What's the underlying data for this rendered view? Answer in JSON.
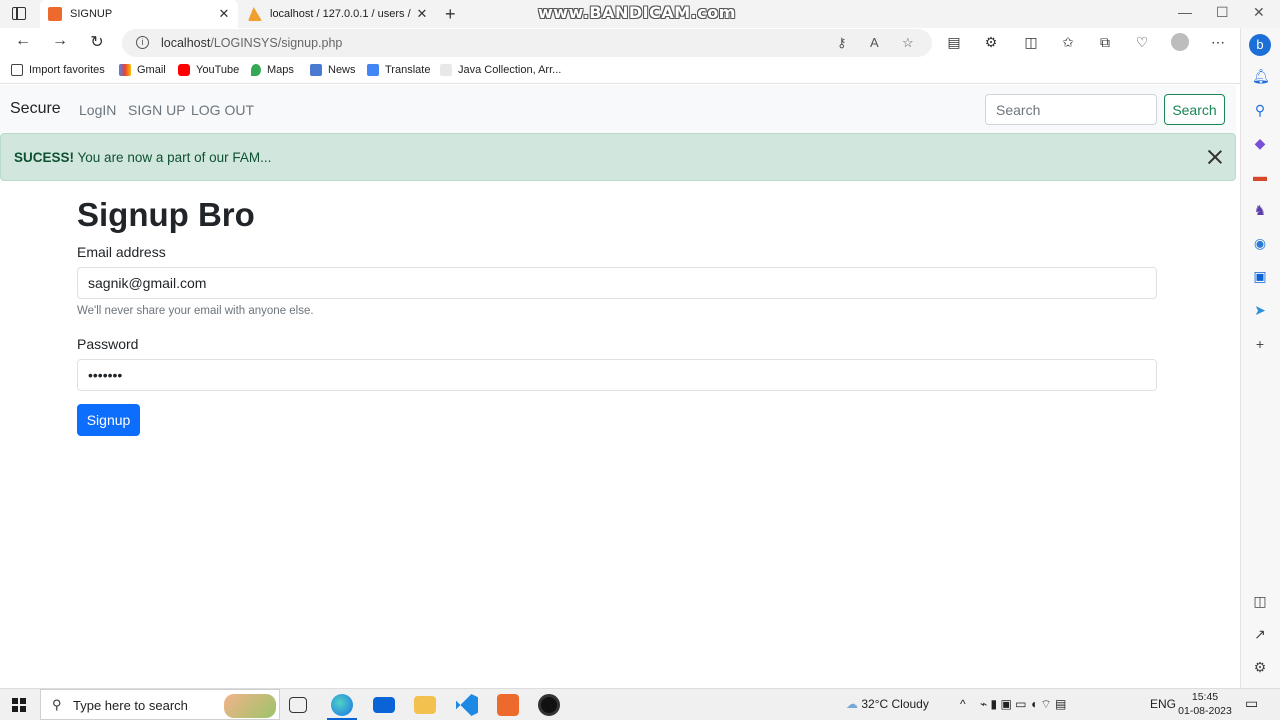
{
  "browser": {
    "tabs": [
      {
        "title": "SIGNUP",
        "active": true
      },
      {
        "title": "localhost / 127.0.0.1 / users / use",
        "active": false
      }
    ],
    "recorder_watermark": "www.BANDICAM.com",
    "url_host": "localhost",
    "url_path": "/LOGINSYS/signup.php",
    "favorites": [
      {
        "label": "Import favorites",
        "icon": "import-icon"
      },
      {
        "label": "Gmail",
        "icon": "gmail-icon"
      },
      {
        "label": "YouTube",
        "icon": "youtube-icon"
      },
      {
        "label": "Maps",
        "icon": "maps-icon"
      },
      {
        "label": "News",
        "icon": "news-icon"
      },
      {
        "label": "Translate",
        "icon": "translate-icon"
      },
      {
        "label": "Java Collection, Arr...",
        "icon": "w3-icon"
      }
    ]
  },
  "navbar": {
    "brand": "Secure",
    "links": [
      "LogIN",
      "SIGN UP",
      "LOG OUT"
    ],
    "search_placeholder": "Search",
    "search_button": "Search"
  },
  "alert": {
    "strong": "SUCESS!",
    "message": " You are now a part of our FAM..."
  },
  "form": {
    "heading": "Signup Bro",
    "email_label": "Email address",
    "email_value": "sagnik@gmail.com",
    "email_help": "We'll never share your email with anyone else.",
    "password_label": "Password",
    "password_value": "•••••••",
    "submit_label": "Signup"
  },
  "taskbar": {
    "search_text": "Type here to search",
    "weather": "32°C  Cloudy",
    "language": "ENG",
    "time": "15:45",
    "date": "01-08-2023"
  },
  "colors": {
    "primary": "#0d6efd",
    "success": "#198754",
    "alert_bg": "#d1e7dd",
    "alert_text": "#0f5132"
  }
}
